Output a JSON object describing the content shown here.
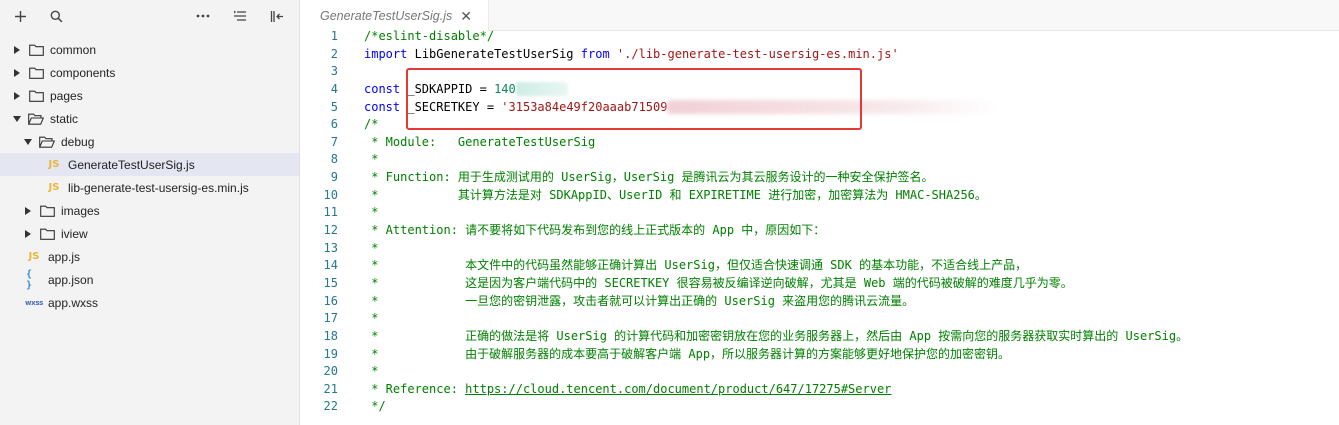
{
  "toolbar": {
    "add_icon": "plus-icon",
    "search_icon": "search-icon",
    "more_icon": "ellipsis-icon",
    "sort_icon": "collapse-list-icon",
    "panel_icon": "panel-collapse-icon"
  },
  "tree": [
    {
      "label": "common",
      "type": "folder",
      "expanded": false,
      "depth": 0
    },
    {
      "label": "components",
      "type": "folder",
      "expanded": false,
      "depth": 0
    },
    {
      "label": "pages",
      "type": "folder",
      "expanded": false,
      "depth": 0
    },
    {
      "label": "static",
      "type": "folder",
      "expanded": true,
      "depth": 0
    },
    {
      "label": "debug",
      "type": "folder",
      "expanded": true,
      "depth": 1
    },
    {
      "label": "GenerateTestUserSig.js",
      "type": "js",
      "depth": 2,
      "selected": true
    },
    {
      "label": "lib-generate-test-usersig-es.min.js",
      "type": "js",
      "depth": 2
    },
    {
      "label": "images",
      "type": "folder",
      "expanded": false,
      "depth": 1
    },
    {
      "label": "iview",
      "type": "folder",
      "expanded": false,
      "depth": 1
    },
    {
      "label": "app.js",
      "type": "js",
      "depth": 0
    },
    {
      "label": "app.json",
      "type": "json",
      "depth": 0
    },
    {
      "label": "app.wxss",
      "type": "wxss",
      "depth": 0
    }
  ],
  "badges": {
    "js": "JS",
    "json": "{ }",
    "wxss": "wxss"
  },
  "tab": {
    "label": "GenerateTestUserSig.js",
    "close": "✕"
  },
  "code": {
    "line_numbers": [
      "1",
      "2",
      "3",
      "4",
      "5",
      "6",
      "7",
      "8",
      "9",
      "10",
      "11",
      "12",
      "13",
      "14",
      "15",
      "16",
      "17",
      "18",
      "19",
      "20",
      "21",
      "22"
    ],
    "l1": "/*eslint-disable*/",
    "l2_import": "import",
    "l2_name": "LibGenerateTestUserSig",
    "l2_from": "from",
    "l2_path": "'./lib-generate-test-usersig-es.min.js'",
    "l4_const": "const",
    "l4_name": "_SDKAPPID",
    "l4_eq": " = ",
    "l4_value": "140",
    "l5_const": "const",
    "l5_name": "_SECRETKEY",
    "l5_eq": " = ",
    "l5_value": "'3153a84e49f20aaab71509",
    "l6": "/*",
    "l7": " * Module:   GenerateTestUserSig",
    "l8": " *",
    "l9": " * Function: 用于生成测试用的 UserSig，UserSig 是腾讯云为其云服务设计的一种安全保护签名。",
    "l10": " *           其计算方法是对 SDKAppID、UserID 和 EXPIRETIME 进行加密，加密算法为 HMAC-SHA256。",
    "l11": " *",
    "l12": " * Attention: 请不要将如下代码发布到您的线上正式版本的 App 中，原因如下：",
    "l13": " *",
    "l14": " *            本文件中的代码虽然能够正确计算出 UserSig，但仅适合快速调通 SDK 的基本功能，不适合线上产品，",
    "l15": " *            这是因为客户端代码中的 SECRETKEY 很容易被反编译逆向破解，尤其是 Web 端的代码被破解的难度几乎为零。",
    "l16": " *            一旦您的密钥泄露，攻击者就可以计算出正确的 UserSig 来盗用您的腾讯云流量。",
    "l17": " *",
    "l18": " *            正确的做法是将 UserSig 的计算代码和加密密钥放在您的业务服务器上，然后由 App 按需向您的服务器获取实时算出的 UserSig。",
    "l19": " *            由于破解服务器的成本要高于破解客户端 App，所以服务器计算的方案能够更好地保护您的加密密钥。",
    "l20": " *",
    "l21_prefix": " * Reference: ",
    "l21_link": "https://cloud.tencent.com/document/product/647/17275#Server",
    "l22": " */"
  },
  "colors": {
    "highlight": "#e53935",
    "keyword": "#0000ff",
    "comment": "#008000",
    "string": "#a31515"
  }
}
